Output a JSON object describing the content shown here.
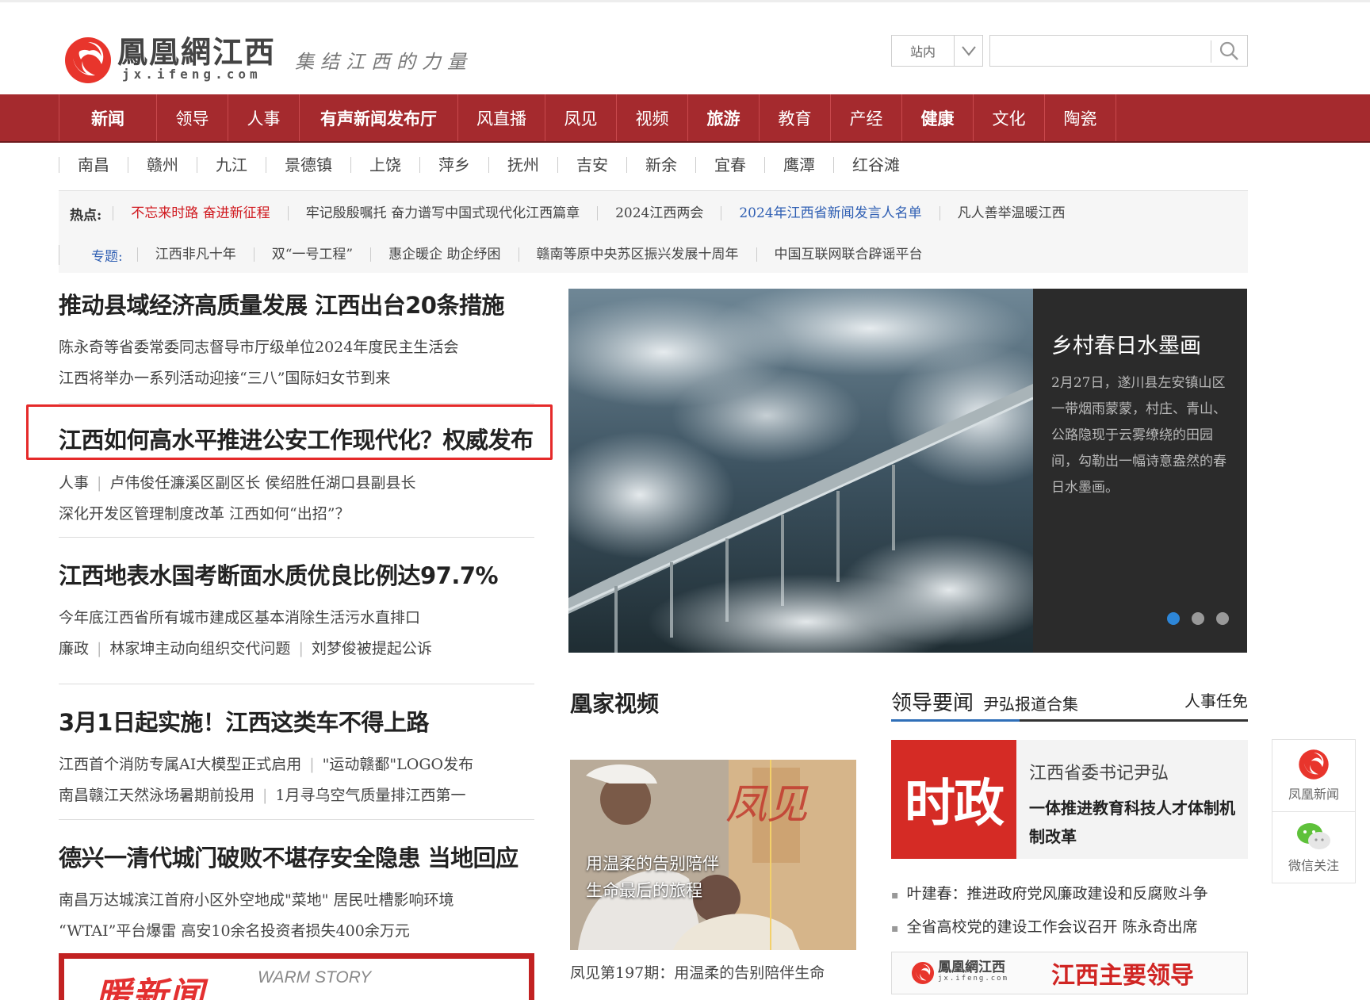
{
  "header": {
    "logo_name": "鳳凰網江西",
    "logo_domain": "jx.ifeng.com",
    "slogan": "集结江西的力量",
    "search_scope": "站内",
    "search_placeholder": ""
  },
  "main_nav": [
    "新闻",
    "领导",
    "人事",
    "有声新闻发布厅",
    "风直播",
    "凤见",
    "视频",
    "旅游",
    "教育",
    "产经",
    "健康",
    "文化",
    "陶瓷"
  ],
  "city_nav": [
    "南昌",
    "赣州",
    "九江",
    "景德镇",
    "上饶",
    "萍乡",
    "抚州",
    "吉安",
    "新余",
    "宜春",
    "鹰潭",
    "红谷滩"
  ],
  "hot": {
    "label": "热点:",
    "items": [
      "不忘来时路 奋进新征程",
      "牢记殷殷嘱托 奋力谱写中国式现代化江西篇章",
      "2024江西两会",
      "2024年江西省新闻发言人名单",
      "凡人善举温暖江西"
    ]
  },
  "topics": {
    "label": "专题:",
    "items": [
      "江西非凡十年",
      "双“一号工程”",
      "惠企暖企 助企纾困",
      "赣南等原中央苏区振兴发展十周年",
      "中国互联网联合辟谣平台"
    ]
  },
  "news": [
    {
      "headline": "推动县域经济高质量发展 江西出台20条措施",
      "subs": [
        [
          "陈永奇等省委常委同志督导市厅级单位2024年度民主生活会"
        ],
        [
          "江西将举办一系列活动迎接“三八”国际妇女节到来"
        ]
      ]
    },
    {
      "headline": "江西如何高水平推进公安工作现代化？权威发布",
      "subs": [
        [
          "人事",
          "卢伟俊任濂溪区副区长 侯绍胜任湖口县副县长"
        ],
        [
          "深化开发区管理制度改革 江西如何“出招”？"
        ]
      ]
    },
    {
      "headline": "江西地表水国考断面水质优良比例达97.7%",
      "subs": [
        [
          "今年底江西省所有城市建成区基本消除生活污水直排口"
        ],
        [
          "廉政",
          "林家坤主动向组织交代问题",
          "刘梦俊被提起公诉"
        ]
      ]
    },
    {
      "headline": "3月1日起实施！江西这类车不得上路",
      "subs": [
        [
          "江西首个消防专属AI大模型正式启用",
          "\"运动赣鄱\"LOGO发布"
        ],
        [
          "南昌赣江天然泳场暑期前投用",
          "1月寻乌空气质量排江西第一"
        ]
      ]
    },
    {
      "headline": "德兴一清代城门破败不堪存安全隐患 当地回应",
      "subs": [
        [
          "南昌万达城滨江首府小区外空地成\"菜地\" 居民吐槽影响环境"
        ],
        [
          "“WTAI”平台爆雷 高安10余名投资者损失400余万元"
        ]
      ]
    }
  ],
  "slider": {
    "title": "乡村春日水墨画",
    "desc": "2月27日，遂川县左安镇山区一带烟雨蒙蒙，村庄、青山、公路隐现于云雾缭绕的田园间，勾勒出一幅诗意盎然的春日水墨画。",
    "active_index": 0,
    "count": 3
  },
  "video": {
    "section_title": "凰家视频",
    "overlay_line1": "用温柔的告别陪伴",
    "overlay_line2": "生命最后的旅程",
    "watermark": "凤见",
    "caption": "凤见第197期：用温柔的告别陪伴生命"
  },
  "leaders": {
    "tab_active": "领导要闻",
    "tab_sub": "尹弘报道合集",
    "tab_right": "人事任免",
    "badge": "时政",
    "card_line1": "江西省委书记尹弘",
    "card_line2": "一体推进教育科技人才体制机制改革",
    "items": [
      "叶建春：推进政府党风廉政建设和反腐败斗争",
      "全省高校党的建设工作会议召开 陈永奇出席"
    ],
    "banner_logo": "鳳凰網江西",
    "banner_domain": "jx.ifeng.com",
    "banner_text": "江西主要领导"
  },
  "warm": {
    "title": "暖新闻",
    "sub": "WARM STORY"
  },
  "side_float": {
    "item1": "凤凰新闻",
    "item2": "微信关注"
  },
  "colors": {
    "nav_red": "#a52a2e",
    "accent_red": "#d0191f",
    "link_blue": "#2f5fb3",
    "dot_active": "#2d86d8"
  }
}
